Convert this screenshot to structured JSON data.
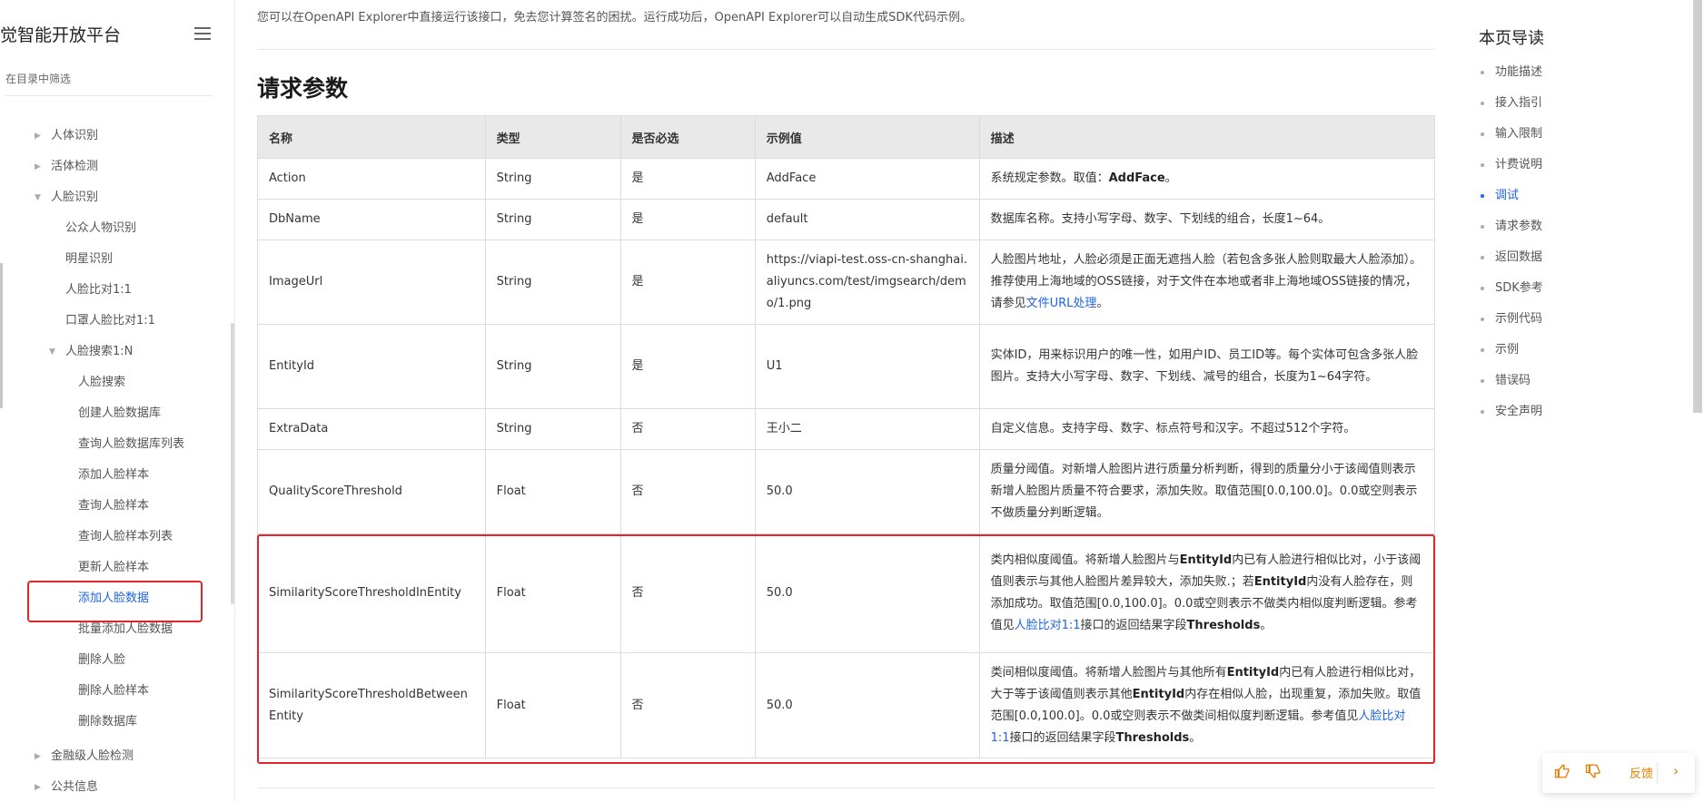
{
  "sidebar": {
    "title": "觉智能开放平台",
    "filter_placeholder": "在目录中筛选",
    "items": [
      {
        "label": "人体识别",
        "collapsed": true
      },
      {
        "label": "活体检测",
        "collapsed": true
      },
      {
        "label": "人脸识别",
        "expanded": true
      },
      {
        "label": "公众人物识别"
      },
      {
        "label": "明星识别"
      },
      {
        "label": "人脸比对1:1"
      },
      {
        "label": "口罩人脸比对1:1"
      },
      {
        "label": "人脸搜索1:N",
        "expanded": true
      },
      {
        "label": "人脸搜索"
      },
      {
        "label": "创建人脸数据库"
      },
      {
        "label": "查询人脸数据库列表"
      },
      {
        "label": "添加人脸样本"
      },
      {
        "label": "查询人脸样本"
      },
      {
        "label": "查询人脸样本列表"
      },
      {
        "label": "更新人脸样本"
      },
      {
        "label": "添加人脸数据",
        "active": true
      },
      {
        "label": "批量添加人脸数据"
      },
      {
        "label": "删除人脸"
      },
      {
        "label": "删除人脸样本"
      },
      {
        "label": "删除数据库"
      },
      {
        "label": "金融级人脸检测",
        "collapsed": true
      },
      {
        "label": "公共信息",
        "collapsed": true
      }
    ]
  },
  "main": {
    "intro_text": "您可以在OpenAPI Explorer中直接运行该接口，免去您计算签名的困扰。运行成功后，OpenAPI Explorer可以自动生成SDK代码示例。",
    "section_title": "请求参数",
    "table": {
      "headers": [
        "名称",
        "类型",
        "是否必选",
        "示例值",
        "描述"
      ],
      "rows": [
        {
          "name": "Action",
          "type": "String",
          "required": "是",
          "example": "AddFace",
          "desc": "系统规定参数。取值：",
          "desc_bold": "AddFace",
          "desc_tail": "。"
        },
        {
          "name": "DbName",
          "type": "String",
          "required": "是",
          "example": "default",
          "desc": "数据库名称。支持小写字母、数字、下划线的组合，长度1~64。"
        },
        {
          "name": "ImageUrl",
          "type": "String",
          "required": "是",
          "example": "https://viapi-test.oss-cn-shanghai.aliyuncs.com/test/imgsearch/demo/1.png",
          "desc": "人脸图片地址，人脸必须是正面无遮挡人脸（若包含多张人脸则取最大人脸添加）。推荐使用上海地域的OSS链接，对于文件在本地或者非上海地域OSS链接的情况，请参见",
          "desc_link": "文件URL处理",
          "desc_tail": "。"
        },
        {
          "name": "EntityId",
          "type": "String",
          "required": "是",
          "example": "U1",
          "desc": "实体ID，用来标识用户的唯一性，如用户ID、员工ID等。每个实体可包含多张人脸图片。支持大小写字母、数字、下划线、减号的组合，长度为1~64字符。"
        },
        {
          "name": "ExtraData",
          "type": "String",
          "required": "否",
          "example": "王小二",
          "desc": "自定义信息。支持字母、数字、标点符号和汉字。不超过512个字符。"
        },
        {
          "name": "QualityScoreThreshold",
          "type": "Float",
          "required": "否",
          "example": "50.0",
          "desc": "质量分阈值。对新增人脸图片进行质量分析判断，得到的质量分小于该阈值则表示新增人脸图片质量不符合要求，添加失败。取值范围[0.0,100.0]。0.0或空则表示不做质量分判断逻辑。"
        },
        {
          "name": "SimilarityScoreThresholdInEntity",
          "type": "Float",
          "required": "否",
          "example": "50.0",
          "desc_a": "类内相似度阈值。将新增人脸图片与",
          "desc_b": "EntityId",
          "desc_c": "内已有人脸进行相似比对，小于该阈值则表示与其他人脸图片差异较大，添加失败.；若",
          "desc_d": "EntityId",
          "desc_e": "内没有人脸存在，则添加成功。取值范围[0.0,100.0]。0.0或空则表示不做类内相似度判断逻辑。参考值见",
          "desc_link": "人脸比对1:1",
          "desc_f": "接口的返回结果字段",
          "desc_g": "Thresholds",
          "desc_h": "。"
        },
        {
          "name": "SimilarityScoreThresholdBetweenEntity",
          "type": "Float",
          "required": "否",
          "example": "50.0",
          "desc_a": "类间相似度阈值。将新增人脸图片与其他所有",
          "desc_b": "EntityId",
          "desc_c": "内已有人脸进行相似比对，大于等于该阈值则表示其他",
          "desc_d": "EntityId",
          "desc_e": "内存在相似人脸，出现重复，添加失败。取值范围[0.0,100.0]。0.0或空则表示不做类间相似度判断逻辑。参考值见",
          "desc_link": "人脸比对1:1",
          "desc_f": "接口的返回结果字段",
          "desc_g": "Thresholds",
          "desc_h": "。"
        }
      ]
    }
  },
  "toc": {
    "title": "本页导读",
    "items": [
      {
        "label": "功能描述"
      },
      {
        "label": "接入指引"
      },
      {
        "label": "输入限制"
      },
      {
        "label": "计费说明"
      },
      {
        "label": "调试",
        "active": true
      },
      {
        "label": "请求参数"
      },
      {
        "label": "返回数据"
      },
      {
        "label": "SDK参考"
      },
      {
        "label": "示例代码"
      },
      {
        "label": "示例"
      },
      {
        "label": "错误码"
      },
      {
        "label": "安全声明"
      }
    ]
  },
  "feedback": {
    "label": "反馈",
    "thumbs_up_icon": "thumbs-up-icon",
    "thumbs_down_icon": "thumbs-down-icon"
  }
}
